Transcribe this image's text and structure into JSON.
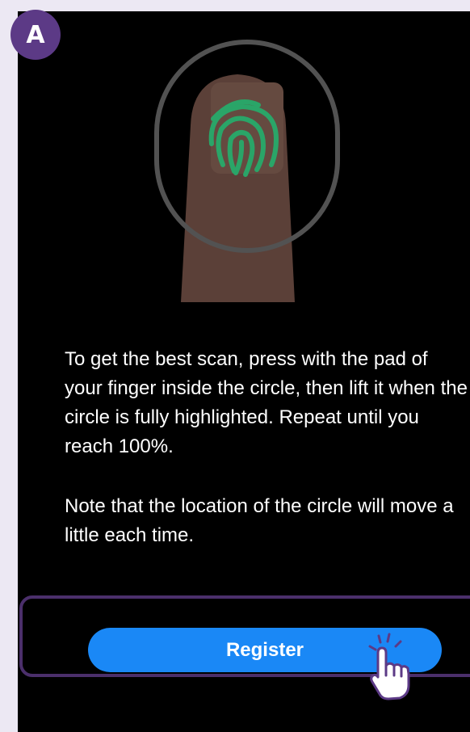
{
  "step": {
    "label": "A"
  },
  "illustration": {
    "icon": "fingerprint-icon",
    "colors": {
      "finger": "#5b4038",
      "fingerprint": "#2aa568",
      "ring": "#525252"
    }
  },
  "content": {
    "instructions": "To get the best scan, press with the pad of your finger inside the circle, then lift it when the circle is fully highlighted. Repeat until you reach 100%.",
    "note": "Note that the location of the circle will move a little each time."
  },
  "actions": {
    "register_label": "Register"
  },
  "cursor": {
    "icon": "hand-pointer-icon"
  },
  "colors": {
    "background": "#000000",
    "accent": "#1a88f6",
    "badge": "#5c3a86",
    "frame": "#4b2f6b"
  }
}
